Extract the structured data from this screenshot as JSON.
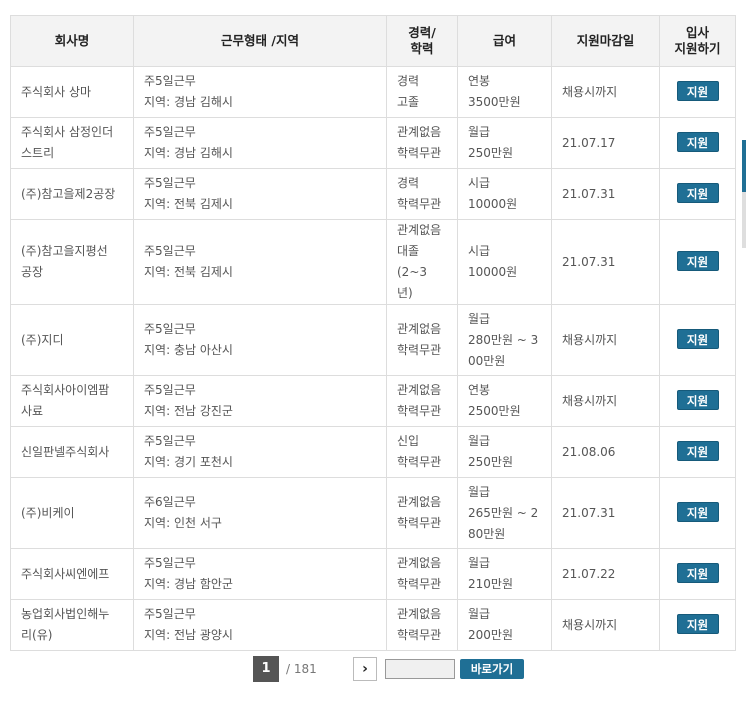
{
  "headers": {
    "company": "회사명",
    "work": "근무형태 /지역",
    "exp": [
      "경력/",
      "학력"
    ],
    "pay": "급여",
    "deadline": "지원마감일",
    "apply": [
      "입사",
      "지원하기"
    ]
  },
  "rows": [
    {
      "company": [
        "주식회사 상마"
      ],
      "work": [
        "주5일근무",
        "지역: 경남 김해시"
      ],
      "exp": [
        "경력",
        "고졸"
      ],
      "pay": [
        "연봉",
        "3500만원"
      ],
      "deadline": "채용시까지",
      "apply": "지원"
    },
    {
      "company": [
        "주식회사 삼정인더",
        "스트리"
      ],
      "work": [
        "주5일근무",
        "지역: 경남 김해시"
      ],
      "exp": [
        "관계없음",
        "학력무관"
      ],
      "pay": [
        "월급",
        "250만원"
      ],
      "deadline": "21.07.17",
      "apply": "지원"
    },
    {
      "company": [
        "(주)참고을제2공장"
      ],
      "work": [
        "주5일근무",
        "지역: 전북 김제시"
      ],
      "exp": [
        "경력",
        "학력무관"
      ],
      "pay": [
        "시급",
        "10000원"
      ],
      "deadline": "21.07.31",
      "apply": "지원"
    },
    {
      "company": [
        "(주)참고을지평선",
        "공장"
      ],
      "work": [
        "주5일근무",
        "지역: 전북 김제시"
      ],
      "exp": [
        "관계없음",
        "대졸(2~3",
        "년)"
      ],
      "pay": [
        "시급",
        "10000원"
      ],
      "deadline": "21.07.31",
      "apply": "지원"
    },
    {
      "company": [
        "(주)지디"
      ],
      "work": [
        "주5일근무",
        "지역: 충남 아산시"
      ],
      "exp": [
        "관계없음",
        "학력무관"
      ],
      "pay": [
        "월급",
        "280만원 ~ 3",
        "00만원"
      ],
      "deadline": "채용시까지",
      "apply": "지원"
    },
    {
      "company": [
        "주식회사아이엠팜",
        "사료"
      ],
      "work": [
        "주5일근무",
        "지역: 전남 강진군"
      ],
      "exp": [
        "관계없음",
        "학력무관"
      ],
      "pay": [
        "연봉",
        "2500만원"
      ],
      "deadline": "채용시까지",
      "apply": "지원"
    },
    {
      "company": [
        "신일판넬주식회사"
      ],
      "work": [
        "주5일근무",
        "지역: 경기 포천시"
      ],
      "exp": [
        "신입",
        "학력무관"
      ],
      "pay": [
        "월급",
        "250만원"
      ],
      "deadline": "21.08.06",
      "apply": "지원"
    },
    {
      "company": [
        "(주)비케이"
      ],
      "work": [
        "주6일근무",
        "지역: 인천 서구"
      ],
      "exp": [
        "관계없음",
        "학력무관"
      ],
      "pay": [
        "월급",
        "265만원 ~ 2",
        "80만원"
      ],
      "deadline": "21.07.31",
      "apply": "지원"
    },
    {
      "company": [
        "주식회사씨엔에프"
      ],
      "work": [
        "주5일근무",
        "지역: 경남 함안군"
      ],
      "exp": [
        "관계없음",
        "학력무관"
      ],
      "pay": [
        "월급",
        "210만원"
      ],
      "deadline": "21.07.22",
      "apply": "지원"
    },
    {
      "company": [
        "농업회사법인해누",
        "리(유)"
      ],
      "work": [
        "주5일근무",
        "지역: 전남 광양시"
      ],
      "exp": [
        "관계없음",
        "학력무관"
      ],
      "pay": [
        "월급",
        "200만원"
      ],
      "deadline": "채용시까지",
      "apply": "지원"
    }
  ],
  "pagination": {
    "current": "1",
    "total": "/ 181",
    "next_icon": "chevron-right-icon",
    "next_symbol": "›",
    "go_label": "바로가기",
    "input_value": ""
  },
  "colors": {
    "accent": "#1f6f95",
    "header_bg": "#f3f3f3",
    "border": "#dddddd"
  }
}
